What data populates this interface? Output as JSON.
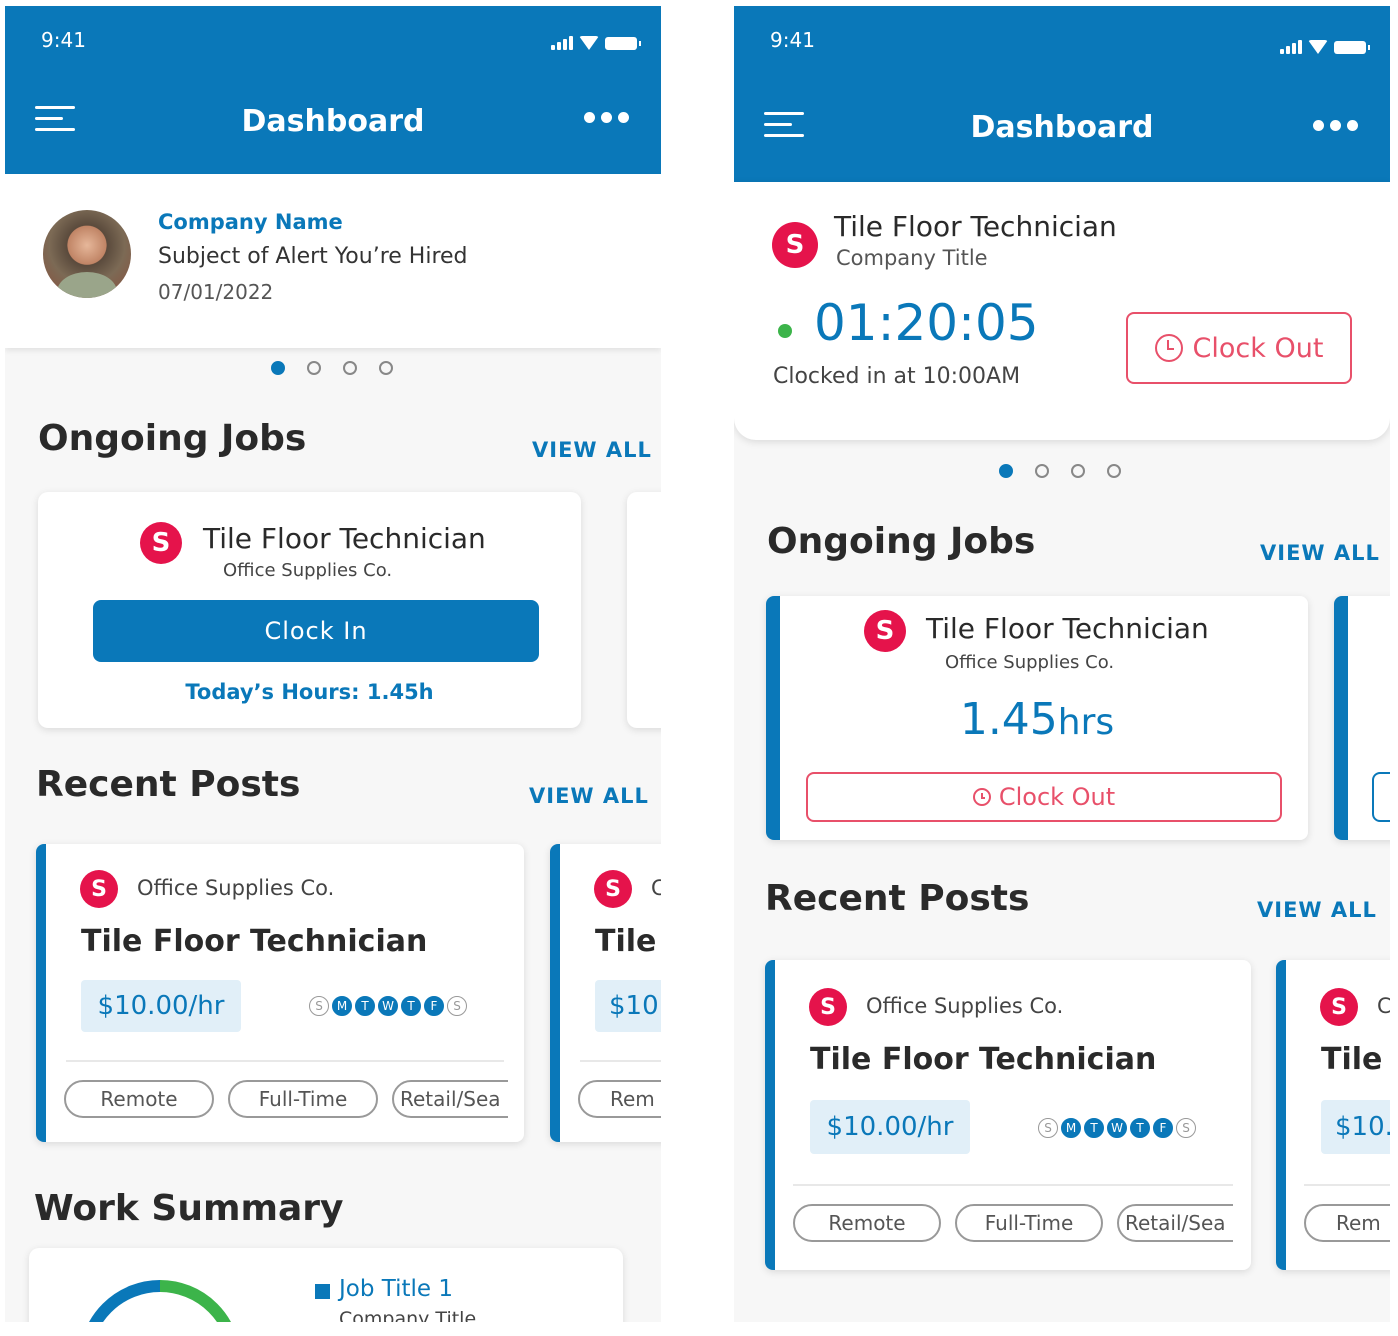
{
  "status_bar": {
    "time": "9:41"
  },
  "header": {
    "title": "Dashboard"
  },
  "alert": {
    "company": "Company Name",
    "subject": "Subject of Alert You’re Hired",
    "date": "07/01/2022"
  },
  "clock_card": {
    "job_title": "Tile Floor Technician",
    "company": "Company Title",
    "timer": "01:20:05",
    "clocked_in": "Clocked in at 10:00AM",
    "button": "Clock Out"
  },
  "ongoing": {
    "heading": "Ongoing Jobs",
    "view_all": "VIEW ALL",
    "job_title": "Tile Floor Technician",
    "company": "Office Supplies Co.",
    "clock_in": "Clock In",
    "today_hours": "Today’s Hours: 1.45h",
    "hours_value": "1.45",
    "hours_unit": "hrs",
    "clock_out": "Clock Out"
  },
  "recent": {
    "heading": "Recent Posts",
    "view_all": "VIEW ALL",
    "company": "Office Supplies Co.",
    "title": "Tile Floor Technician",
    "rate": "$10.00/hr",
    "days": [
      {
        "letter": "S",
        "active": false
      },
      {
        "letter": "M",
        "active": true
      },
      {
        "letter": "T",
        "active": true
      },
      {
        "letter": "W",
        "active": true
      },
      {
        "letter": "T",
        "active": true
      },
      {
        "letter": "F",
        "active": true
      },
      {
        "letter": "S",
        "active": false
      }
    ],
    "tags": [
      "Remote",
      "Full-Time",
      "Retail/Sea"
    ],
    "peek_title": "Tile",
    "peek_rate": "$10.",
    "peek_tag": "Rem",
    "peek_company": "C"
  },
  "work_summary": {
    "heading": "Work Summary",
    "legend_title": "Job Title 1",
    "legend_company": "Company Title"
  },
  "colors": {
    "primary": "#0a78b9",
    "accent": "#e5134b",
    "danger": "#e8506a",
    "online": "#3cb44a"
  }
}
